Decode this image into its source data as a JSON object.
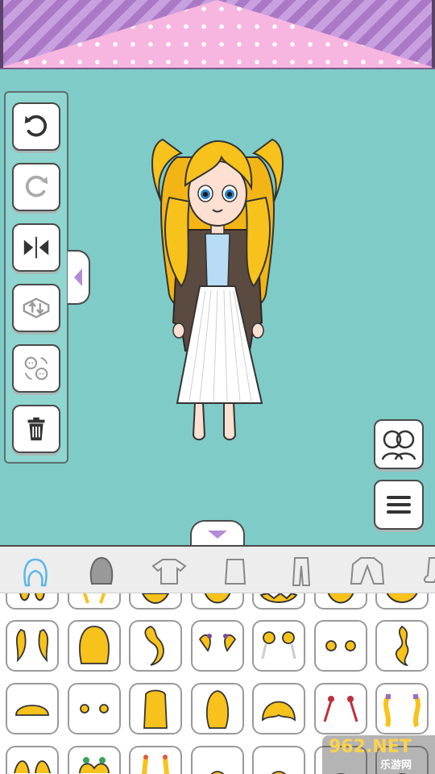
{
  "colors": {
    "background": "#7fcbc7",
    "awning_stripe": "#b78ad1",
    "curtain_pink": "#f7b6e0",
    "hair": "#f7c21b",
    "icon_blue": "#5ab6e8",
    "icon_gray": "#9a9a9a"
  },
  "toolbar": {
    "tools": [
      {
        "name": "undo-icon",
        "enabled": true
      },
      {
        "name": "redo-icon",
        "enabled": false
      },
      {
        "name": "flip-icon",
        "enabled": true
      },
      {
        "name": "layer-order-icon",
        "enabled": false
      },
      {
        "name": "swap-character-icon",
        "enabled": false
      },
      {
        "name": "trash-icon",
        "enabled": true
      }
    ]
  },
  "right_buttons": [
    "characters-icon",
    "menu-icon"
  ],
  "categories": [
    {
      "name": "hair-front-icon",
      "active": true
    },
    {
      "name": "hair-back-icon",
      "active": false
    },
    {
      "name": "shirt-icon",
      "active": false
    },
    {
      "name": "skirt-icon",
      "active": false
    },
    {
      "name": "pants-icon",
      "active": false
    },
    {
      "name": "jacket-icon",
      "active": false
    },
    {
      "name": "socks-icon",
      "active": false
    }
  ],
  "items_visible": 28,
  "watermark": {
    "main": "962.NET",
    "sub": "乐游网"
  }
}
